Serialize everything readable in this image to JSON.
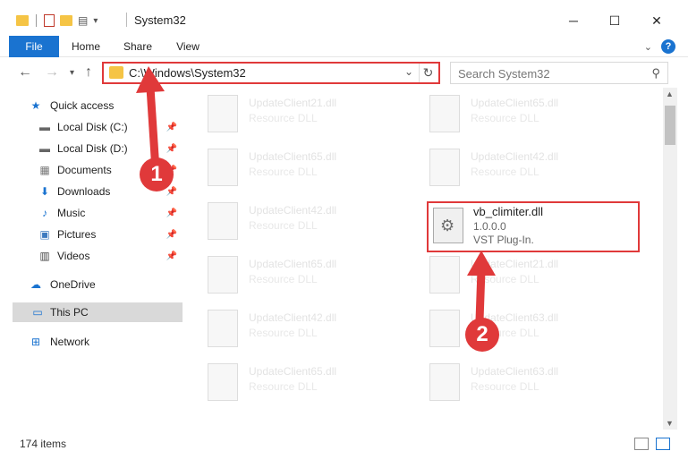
{
  "window": {
    "title": "System32",
    "controls": {
      "minimize": "─",
      "maximize": "☐",
      "close": "✕"
    }
  },
  "ribbon": {
    "tabs": [
      "File",
      "Home",
      "Share",
      "View"
    ],
    "expand_icon": "chevron-down-icon",
    "help_label": "?"
  },
  "nav": {
    "address": "C:\\Windows\\System32",
    "search_placeholder": "Search System32"
  },
  "sidebar": {
    "items": [
      {
        "label": "Quick access"
      },
      {
        "label": "Local Disk (C:)"
      },
      {
        "label": "Local Disk (D:)"
      },
      {
        "label": "Documents"
      },
      {
        "label": "Downloads"
      },
      {
        "label": "Music"
      },
      {
        "label": "Pictures"
      },
      {
        "label": "Videos"
      },
      {
        "label": "OneDrive"
      },
      {
        "label": "This PC"
      },
      {
        "label": "Network"
      }
    ]
  },
  "files": {
    "left": [
      {
        "name": "UpdateClient21.dll",
        "type": "Resource DLL"
      },
      {
        "name": "UpdateClient65.dll",
        "type": "Resource DLL"
      },
      {
        "name": "UpdateClient42.dll",
        "type": "Resource DLL"
      },
      {
        "name": "UpdateClient65.dll",
        "type": "Resource DLL"
      },
      {
        "name": "UpdateClient42.dll",
        "type": "Resource DLL"
      },
      {
        "name": "UpdateClient65.dll",
        "type": "Resource DLL"
      }
    ],
    "right": [
      {
        "name": "UpdateClient65.dll",
        "type": "Resource DLL"
      },
      {
        "name": "UpdateClient42.dll",
        "type": "Resource DLL"
      },
      {
        "name": "UpdateClient21.dll",
        "type": "Resource DLL"
      },
      {
        "name": "UpdateClient63.dll",
        "type": "Resource DLL"
      },
      {
        "name": "UpdateClient63.dll",
        "type": "Resource DLL"
      }
    ],
    "highlighted": {
      "name": "vb_climiter.dll",
      "version": "1.0.0.0",
      "description": "VST Plug-In."
    }
  },
  "annotations": {
    "badge1": "1",
    "badge2": "2"
  },
  "status": {
    "count": "174 items"
  },
  "colors": {
    "accent": "#1a73d0",
    "highlight_red": "#e0393a"
  }
}
